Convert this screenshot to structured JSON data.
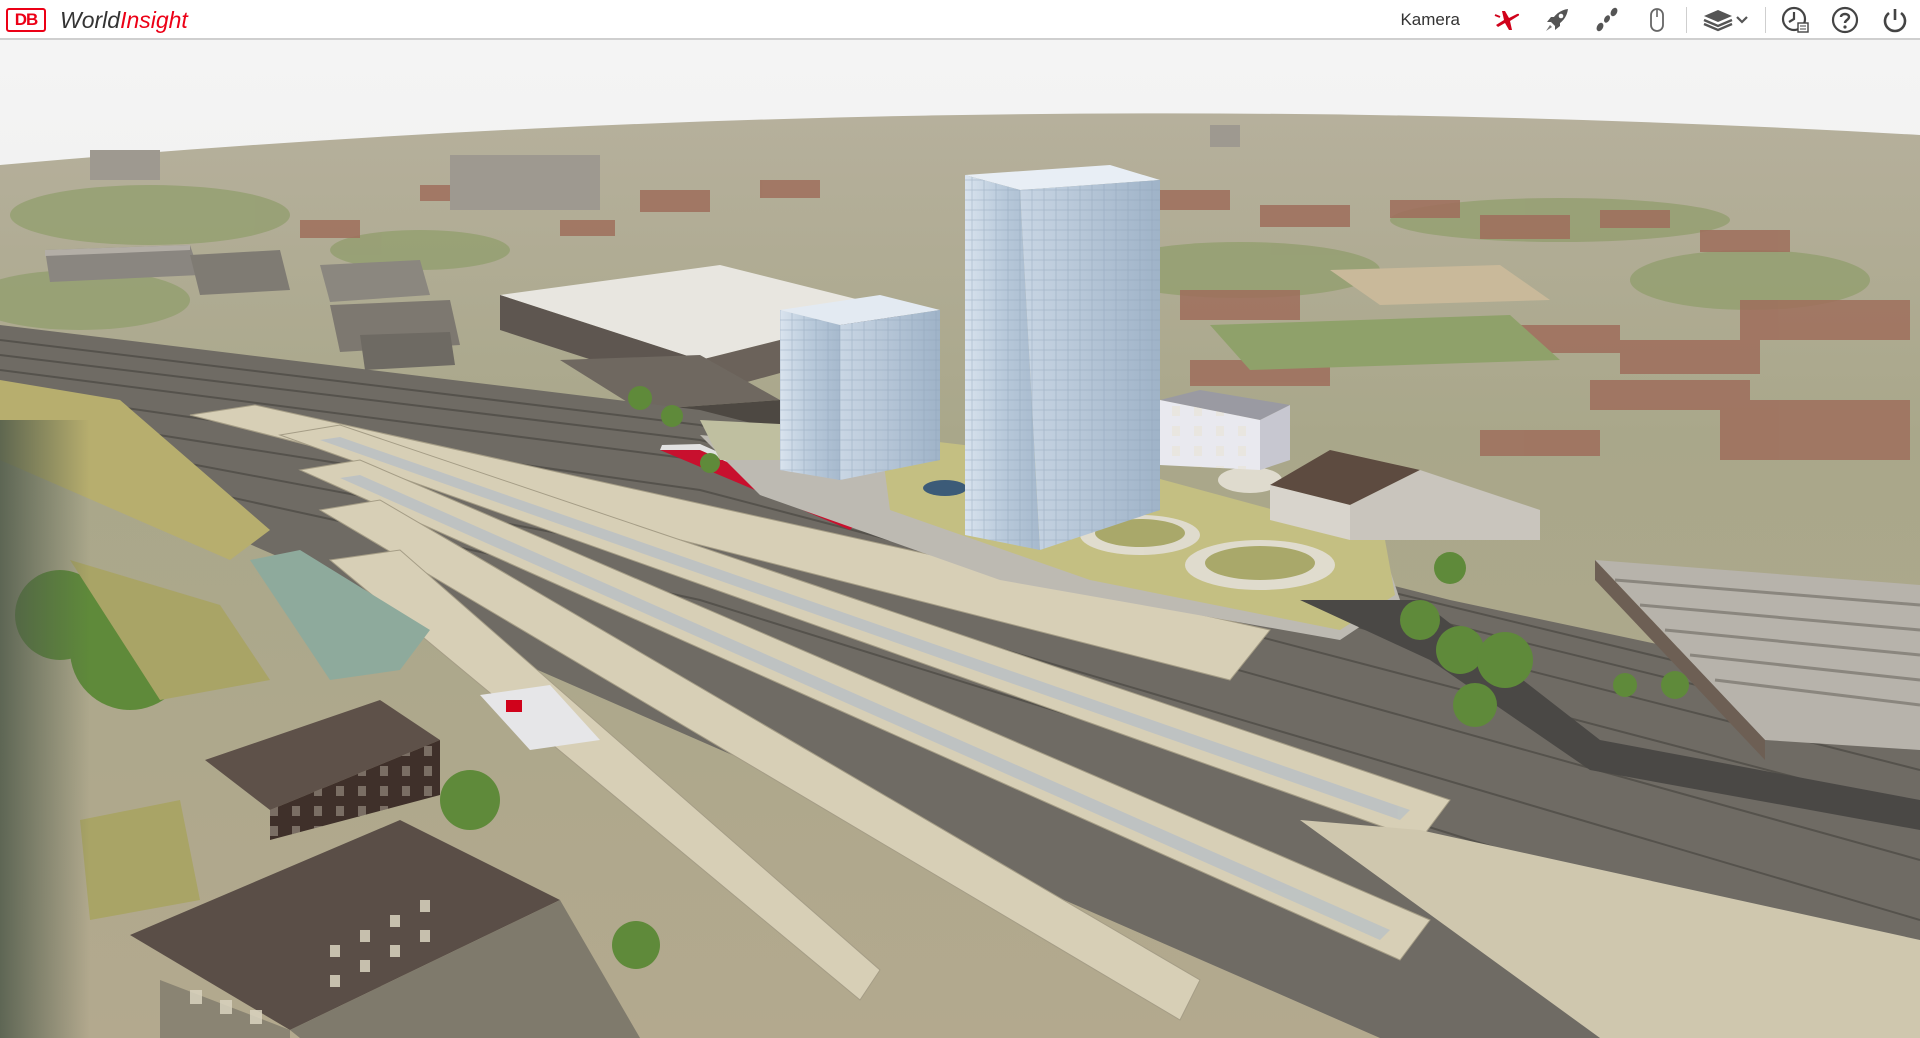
{
  "app": {
    "logo_text": "DB",
    "name_part1": "World",
    "name_part2": "Insight",
    "brand_color": "#ec0016"
  },
  "toolbar": {
    "camera_label": "Kamera",
    "buttons": [
      {
        "id": "flight",
        "icon": "airplane-icon"
      },
      {
        "id": "rocket",
        "icon": "rocket-icon"
      },
      {
        "id": "walk",
        "icon": "footsteps-icon"
      },
      {
        "id": "mouse",
        "icon": "mouse-icon"
      },
      {
        "id": "layers",
        "icon": "layers-dropdown-icon"
      },
      {
        "id": "time",
        "icon": "clock-icon"
      },
      {
        "id": "help",
        "icon": "help-icon"
      },
      {
        "id": "power",
        "icon": "power-icon"
      }
    ]
  },
  "scene": {
    "description_kind": "3d-aerial-railway-station",
    "colors": {
      "sky": "#f2f2f2",
      "ground": "#b7ad92",
      "tracks": "#6e6a63",
      "platform": "#d6cdb4",
      "grass": "#b9b26a",
      "glass": "#c8d6e6",
      "roof": "#9a5e4c",
      "train": "#c8102e"
    }
  }
}
